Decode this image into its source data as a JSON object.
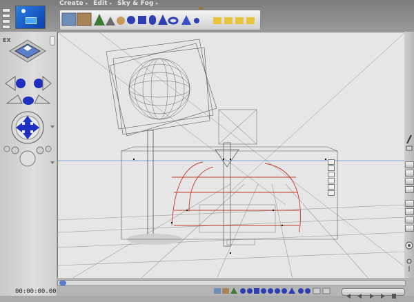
{
  "menu": {
    "create": "Create",
    "edit": "Edit",
    "sky_fog": "Sky & Fog",
    "arrow": "▸"
  },
  "timeline": {
    "timecode": "00:00:00.00"
  },
  "colors": {
    "accent_blue": "#1f2fbf",
    "wire_red": "#c0392b",
    "horizon": "#5b8fd6",
    "wire_gray": "#555555"
  },
  "icons": {
    "library_tray": [
      "landscape-icon",
      "terrain-icon",
      "tree-icon",
      "rock-icon",
      "plant-icon",
      "sphere-icon",
      "cube-icon",
      "cylinder-icon",
      "cone-icon",
      "torus-icon",
      "pyramid-icon",
      "light-icon",
      "figure-icon",
      "material-icons"
    ],
    "left_panel": [
      "camera-preview-icon",
      "view-cube-icon",
      "move-arrows-icon",
      "rotate-icon",
      "trackball-icon",
      "zoom-icon"
    ],
    "right_strip": [
      "render-brush-icon",
      "options-icon",
      "toggle-icons",
      "zoom-icon"
    ]
  }
}
